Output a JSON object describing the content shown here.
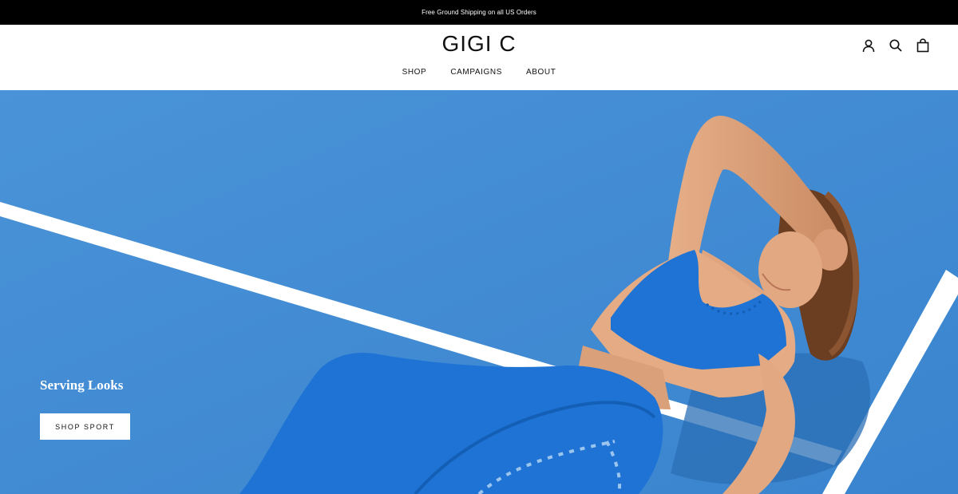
{
  "announcement": {
    "text": "Free Ground Shipping on all US Orders"
  },
  "header": {
    "logo": "GIGI C",
    "nav": [
      {
        "label": "SHOP"
      },
      {
        "label": "CAMPAIGNS"
      },
      {
        "label": "ABOUT"
      }
    ],
    "icons": [
      "account-icon",
      "search-icon",
      "bag-icon"
    ]
  },
  "hero": {
    "title": "Serving Looks",
    "button_label": "SHOP SPORT"
  },
  "colors": {
    "announcement_bg": "#000000",
    "court_blue": "#3f8ad2",
    "outfit_blue": "#1e73d4",
    "court_line": "#ffffff"
  }
}
